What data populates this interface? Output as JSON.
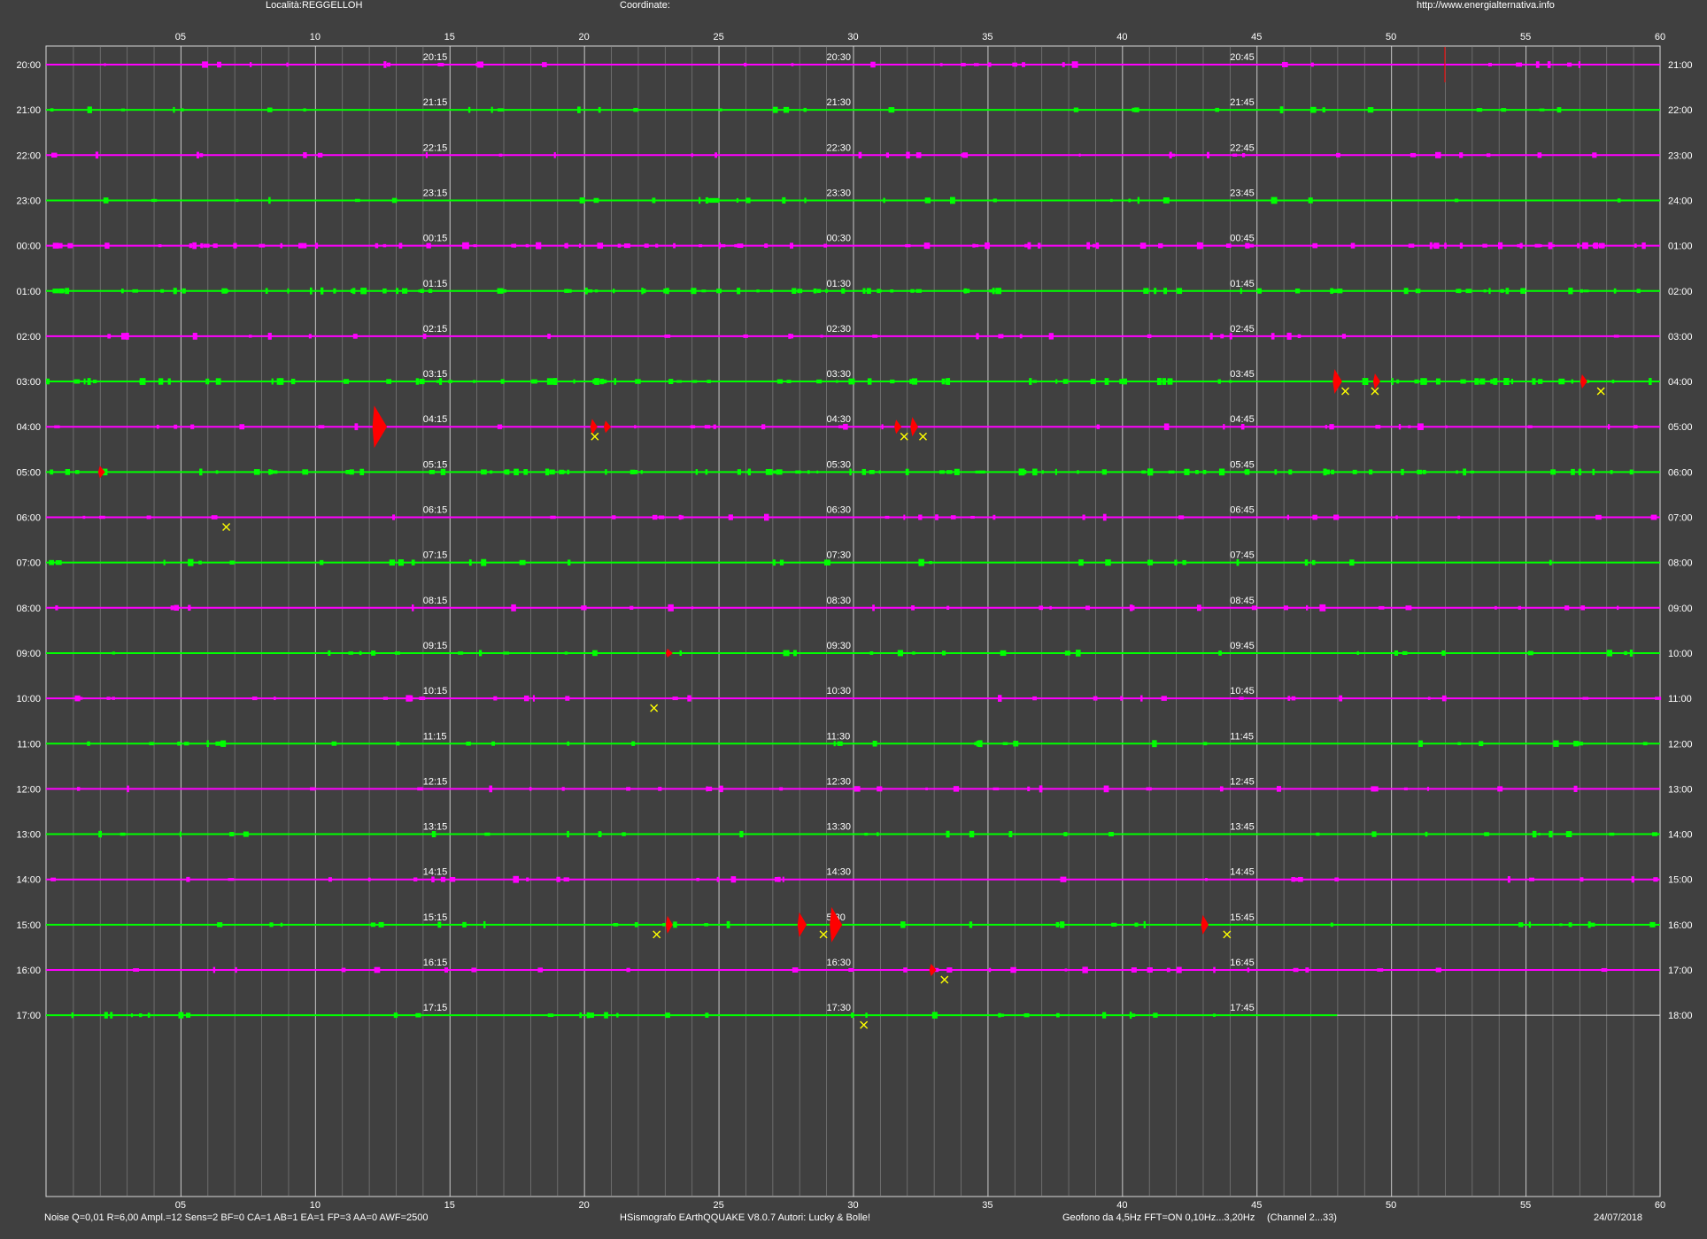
{
  "header": {
    "location": "Località:REGGELLOH",
    "coordinates": "Coordinate:",
    "url": "http://www.energialternativa.info"
  },
  "footer": {
    "params": "Noise Q=0,01 R=6,00 Ampl.=12 Sens=2 BF=0 CA=1 AB=1 EA=1 FP=3 AA=0 AWF=2500",
    "app": "HSismografo EArthQQUAKE  V8.0.7  Autori: Lucky & Bolle!",
    "geofono": "Geofono da 4,5Hz FFT=ON 0,10Hz...3,20Hz",
    "channel": "(Channel 2...33)",
    "date": "24/07/2018"
  },
  "minute_axis_labels": [
    "05",
    "10",
    "15",
    "20",
    "25",
    "30",
    "35",
    "40",
    "45",
    "50",
    "55",
    "60"
  ],
  "left_hours": [
    "20:00",
    "21:00",
    "22:00",
    "23:00",
    "00:00",
    "01:00",
    "02:00",
    "03:00",
    "04:00",
    "05:00",
    "06:00",
    "07:00",
    "08:00",
    "09:00",
    "10:00",
    "11:00",
    "12:00",
    "13:00",
    "14:00",
    "15:00",
    "16:00",
    "17:00"
  ],
  "right_hours": [
    "21:00",
    "22:00",
    "23:00",
    "24:00",
    "01:00",
    "02:00",
    "03:00",
    "04:00",
    "05:00",
    "06:00",
    "07:00",
    "08:00",
    "09:00",
    "10:00",
    "11:00",
    "12:00",
    "13:00",
    "14:00",
    "15:00",
    "16:00",
    "17:00",
    "18:00"
  ],
  "quarter_marks": [
    [
      "20:15",
      "20:30",
      "20:45"
    ],
    [
      "21:15",
      "21:30",
      "21:45"
    ],
    [
      "22:15",
      "22:30",
      "22:45"
    ],
    [
      "23:15",
      "23:30",
      "23:45"
    ],
    [
      "00:15",
      "00:30",
      "00:45"
    ],
    [
      "01:15",
      "01:30",
      "01:45"
    ],
    [
      "02:15",
      "02:30",
      "02:45"
    ],
    [
      "03:15",
      "03:30",
      "03:45"
    ],
    [
      "04:15",
      "04:30",
      "04:45"
    ],
    [
      "05:15",
      "05:30",
      "05:45"
    ],
    [
      "06:15",
      "06:30",
      "06:45"
    ],
    [
      "07:15",
      "07:30",
      "07:45"
    ],
    [
      "08:15",
      "08:30",
      "08:45"
    ],
    [
      "09:15",
      "09:30",
      "09:45"
    ],
    [
      "10:15",
      "10:30",
      "10:45"
    ],
    [
      "11:15",
      "11:30",
      "11:45"
    ],
    [
      "12:15",
      "12:30",
      "12:45"
    ],
    [
      "13:15",
      "13:30",
      "13:45"
    ],
    [
      "14:15",
      "14:30",
      "14:45"
    ],
    [
      "15:15",
      "5:30",
      "15:45"
    ],
    [
      "16:15",
      "16:30",
      "16:45"
    ],
    [
      "17:15",
      "17:30",
      "17:45"
    ]
  ],
  "colors": {
    "background": "#404040",
    "magenta_trace": "#ff00ff",
    "green_trace": "#00ff00",
    "event": "#ff0000",
    "marker": "#ffff00",
    "grid_major": "#d8d8d8",
    "grid_minor": "#8a8a8a"
  },
  "trace_end_last_row_minute": 48.0,
  "events": [
    {
      "row": 7,
      "minute": 47.9,
      "amp": 14
    },
    {
      "row": 7,
      "minute": 49.4,
      "amp": 9
    },
    {
      "row": 7,
      "minute": 57.1,
      "amp": 8
    },
    {
      "row": 8,
      "minute": 12.2,
      "amp": 24
    },
    {
      "row": 8,
      "minute": 20.3,
      "amp": 9
    },
    {
      "row": 8,
      "minute": 20.8,
      "amp": 7
    },
    {
      "row": 8,
      "minute": 31.6,
      "amp": 8
    },
    {
      "row": 8,
      "minute": 32.2,
      "amp": 11
    },
    {
      "row": 9,
      "minute": 2.0,
      "amp": 7
    },
    {
      "row": 13,
      "minute": 23.1,
      "amp": 5
    },
    {
      "row": 19,
      "minute": 23.1,
      "amp": 10
    },
    {
      "row": 19,
      "minute": 28.0,
      "amp": 14
    },
    {
      "row": 19,
      "minute": 29.2,
      "amp": 20
    },
    {
      "row": 19,
      "minute": 43.0,
      "amp": 11
    },
    {
      "row": 20,
      "minute": 32.9,
      "amp": 7
    }
  ],
  "markers": [
    {
      "row": 7,
      "minute": 48.3
    },
    {
      "row": 7,
      "minute": 49.4
    },
    {
      "row": 7,
      "minute": 57.8
    },
    {
      "row": 8,
      "minute": 20.4
    },
    {
      "row": 8,
      "minute": 31.9
    },
    {
      "row": 8,
      "minute": 32.6
    },
    {
      "row": 10,
      "minute": 6.7
    },
    {
      "row": 14,
      "minute": 22.6
    },
    {
      "row": 19,
      "minute": 22.7
    },
    {
      "row": 19,
      "minute": 28.9
    },
    {
      "row": 19,
      "minute": 43.9
    },
    {
      "row": 20,
      "minute": 33.4
    },
    {
      "row": 21,
      "minute": 30.4
    }
  ],
  "red_spike_row0_minute": 52.0
}
